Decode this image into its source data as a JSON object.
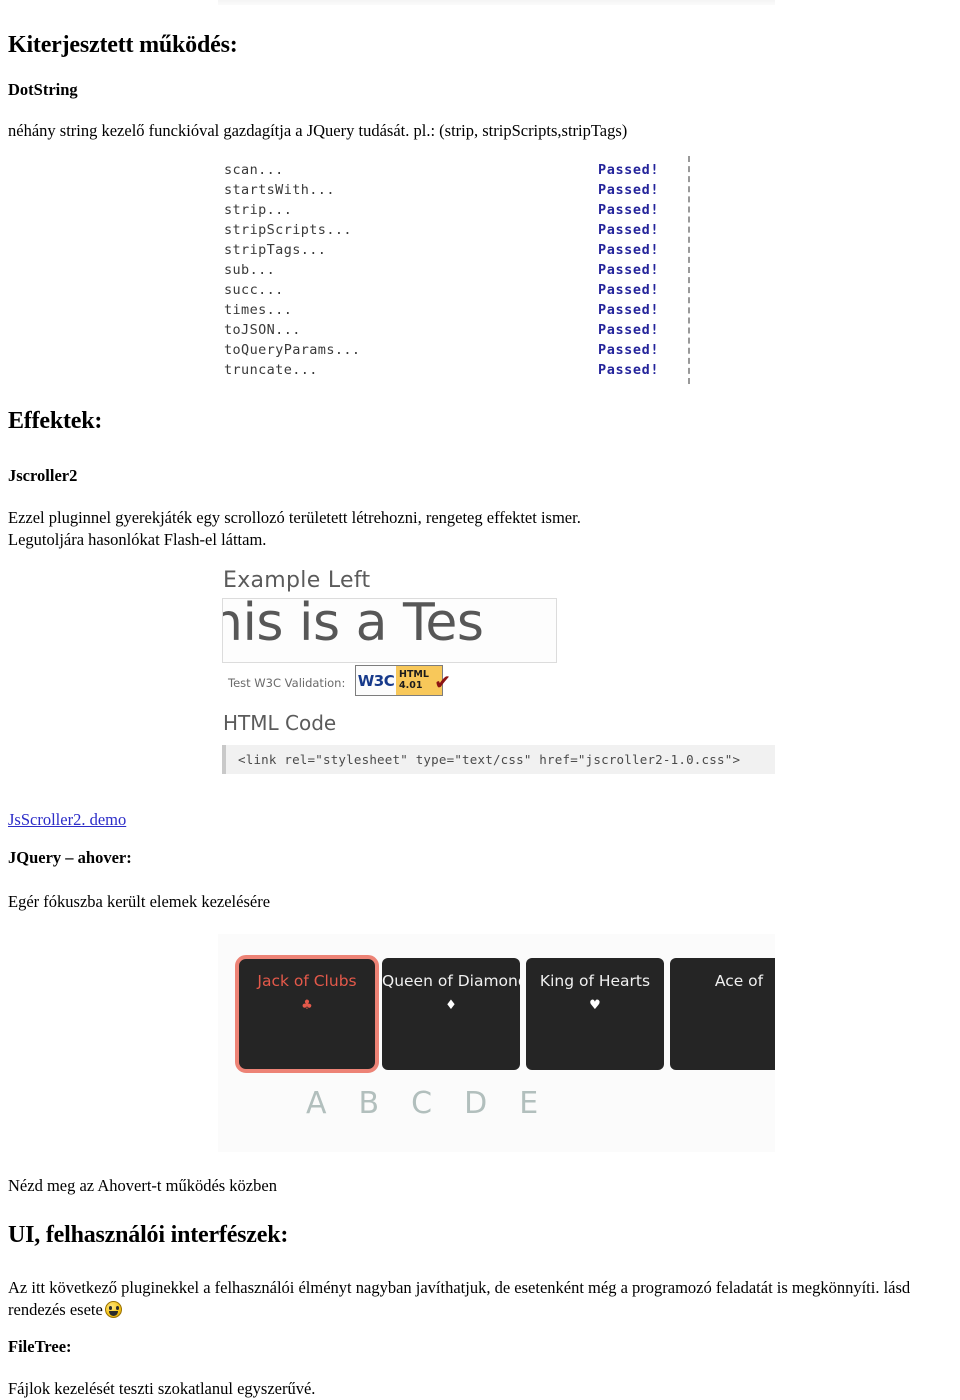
{
  "document": {
    "language": "hu",
    "sections": {
      "extended": {
        "heading": "Kiterjesztett működés:",
        "subheading": "DotString",
        "description": "néhány string kezelő funckióval gazdagítja a JQuery tudását. pl.: (strip, stripScripts,stripTags)"
      },
      "effects": {
        "heading": "Effektek:",
        "subheading": "Jscroller2",
        "description_line1": "Ezzel pluginnel gyerekjáték egy scrollozó területett létrehozni, rengeteg effektet ismer.",
        "description_line2": "Legutoljára hasonlókat Flash-el láttam.",
        "demo_link": "JsScroller2. demo"
      },
      "ahover": {
        "heading": "JQuery – ahover:",
        "description": "Egér fókuszba került elemek kezelésére",
        "demo_caption": "Nézd meg az Ahovert-t működés közben"
      },
      "ui": {
        "heading": "UI, felhasználói interfészek:",
        "description_line1": "Az itt következő pluginekkel a felhasználói élményt nagyban javíthatjuk, de esetenként még a programozó feladatát is megkönnyíti. lásd",
        "description_line2": "rendezés esete",
        "emoji": "grinning-face",
        "subheading": "FileTree:",
        "filetree_description": "Fájlok kezelését teszti szokatlanul egyszerűvé."
      }
    }
  },
  "test_results": {
    "status_label": "Passed!",
    "rows": [
      {
        "name": "scan...",
        "status": "Passed!"
      },
      {
        "name": "startsWith...",
        "status": "Passed!"
      },
      {
        "name": "strip...",
        "status": "Passed!"
      },
      {
        "name": "stripScripts...",
        "status": "Passed!"
      },
      {
        "name": "stripTags...",
        "status": "Passed!"
      },
      {
        "name": "sub...",
        "status": "Passed!"
      },
      {
        "name": "succ...",
        "status": "Passed!"
      },
      {
        "name": "times...",
        "status": "Passed!"
      },
      {
        "name": "toJSON...",
        "status": "Passed!"
      },
      {
        "name": "toQueryParams...",
        "status": "Passed!"
      },
      {
        "name": "truncate...",
        "status": "Passed!"
      }
    ],
    "pass_color": "#24249b"
  },
  "jscroller_demo": {
    "title": "Example Left",
    "marquee_text": "his is a Tes",
    "validation_label": "Test W3C Validation:",
    "badge": {
      "left_text": "W3C",
      "line1": "HTML",
      "line2": "4.01",
      "check": "✔",
      "background": "#f8c85a"
    },
    "code_heading": "HTML Code",
    "code_snippet": "<link rel=\"stylesheet\" type=\"text/css\" href=\"jscroller2-1.0.css\">"
  },
  "ahover_demo": {
    "cards": [
      {
        "title": "Jack of Clubs",
        "suit": "♣",
        "active": true
      },
      {
        "title": "Queen of Diamonds",
        "suit": "♦",
        "active": false
      },
      {
        "title": "King of Hearts",
        "suit": "♥",
        "active": false
      },
      {
        "title": "Ace of",
        "suit": "",
        "active": false
      }
    ],
    "letters": [
      "A",
      "B",
      "C",
      "D",
      "E"
    ],
    "highlight_color": "#ed8376",
    "card_background": "#252525",
    "letter_color": "#b2bfbd"
  }
}
